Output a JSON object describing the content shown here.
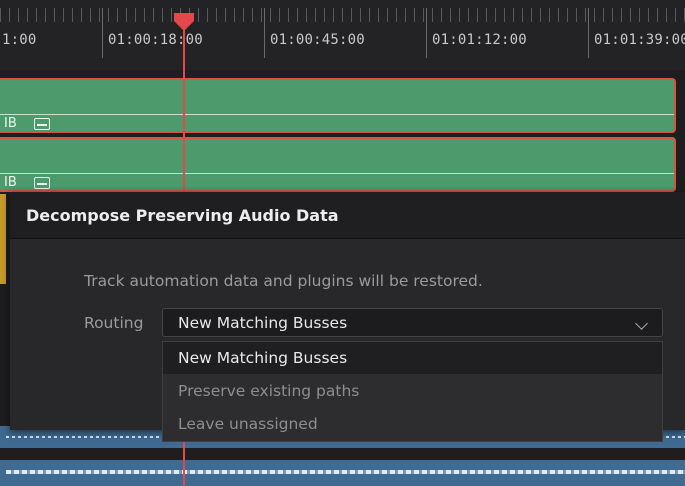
{
  "ruler": {
    "timecodes": [
      "1:00",
      "01:00:18:00",
      "01:00:45:00",
      "01:01:12:00",
      "01:01:39:00"
    ]
  },
  "tracks": {
    "clip_label": "IB"
  },
  "colors": {
    "clip_green": "#4d9b6c",
    "clip_border": "#d9543f",
    "playhead": "#e5484a",
    "audio_blue": "#3f6b93"
  },
  "dialog": {
    "title": "Decompose Preserving Audio Data",
    "message": "Track automation data and plugins will be restored.",
    "routing_label": "Routing",
    "routing_value": "New Matching Busses",
    "options": [
      "New Matching Busses",
      "Preserve existing paths",
      "Leave unassigned"
    ],
    "highlighted_option": "New Matching Busses"
  }
}
